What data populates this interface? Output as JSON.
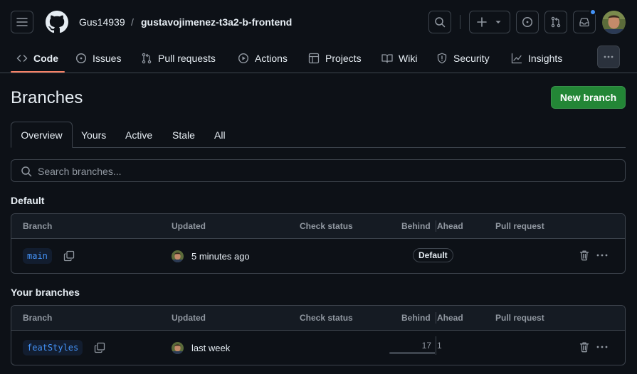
{
  "header": {
    "owner": "Gus14939",
    "separator": "/",
    "repo": "gustavojimenez-t3a2-b-frontend"
  },
  "nav": {
    "code": "Code",
    "issues": "Issues",
    "pull_requests": "Pull requests",
    "actions": "Actions",
    "projects": "Projects",
    "wiki": "Wiki",
    "security": "Security",
    "insights": "Insights"
  },
  "page": {
    "title": "Branches",
    "new_branch": "New branch"
  },
  "tabs": {
    "overview": "Overview",
    "yours": "Yours",
    "active": "Active",
    "stale": "Stale",
    "all": "All"
  },
  "search": {
    "placeholder": "Search branches..."
  },
  "columns": {
    "branch": "Branch",
    "updated": "Updated",
    "check_status": "Check status",
    "behind": "Behind",
    "ahead": "Ahead",
    "pull_request": "Pull request"
  },
  "default_section": {
    "title": "Default",
    "row": {
      "branch": "main",
      "updated": "5 minutes ago",
      "badge": "Default"
    }
  },
  "your_section": {
    "title": "Your branches",
    "row": {
      "branch": "featStyles",
      "updated": "last week",
      "behind": "17",
      "ahead": "1"
    }
  },
  "colors": {
    "background": "#0d1117",
    "accent_underline": "#f78166",
    "primary_button": "#238636",
    "link_blue": "#4493f8",
    "border": "#3d444d"
  }
}
